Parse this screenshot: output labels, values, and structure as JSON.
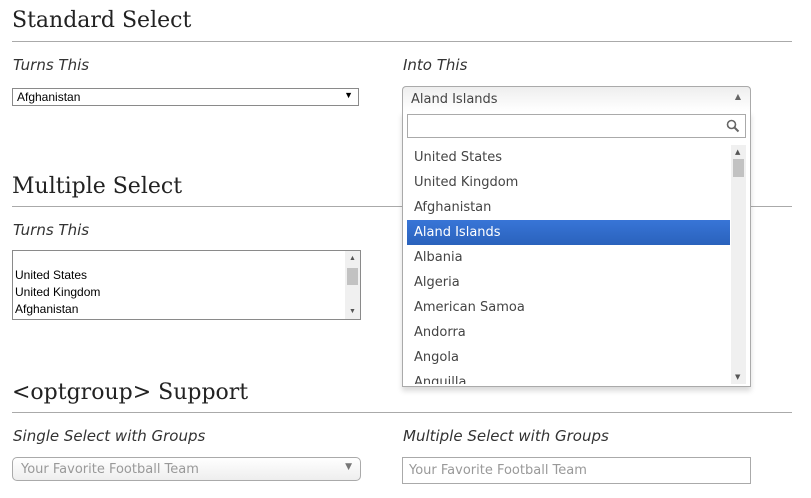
{
  "sections": {
    "standard": {
      "title": "Standard Select",
      "left_label": "Turns This",
      "right_label": "Into This",
      "native_value": "Afghanistan",
      "chosen_value": "Aland Islands",
      "search_placeholder": "",
      "results": [
        "United States",
        "United Kingdom",
        "Afghanistan",
        "Aland Islands",
        "Albania",
        "Algeria",
        "American Samoa",
        "Andorra",
        "Angola",
        "Anguilla"
      ],
      "highlighted_result": "Aland Islands"
    },
    "multiple": {
      "title": "Multiple Select",
      "left_label": "Turns This",
      "list_options": [
        "United States",
        "United Kingdom",
        "Afghanistan"
      ]
    },
    "optgroup": {
      "title": "<optgroup> Support",
      "left_label": "Single Select with Groups",
      "right_label": "Multiple Select with Groups",
      "single_placeholder": "Your Favorite Football Team",
      "multi_placeholder": "Your Favorite Football Team"
    }
  },
  "colors": {
    "highlight": "#3875d7",
    "border": "#aaaaaa"
  },
  "icons": {
    "search": "search-icon",
    "dropdown": "triangle-down-icon",
    "collapse": "triangle-up-icon"
  }
}
